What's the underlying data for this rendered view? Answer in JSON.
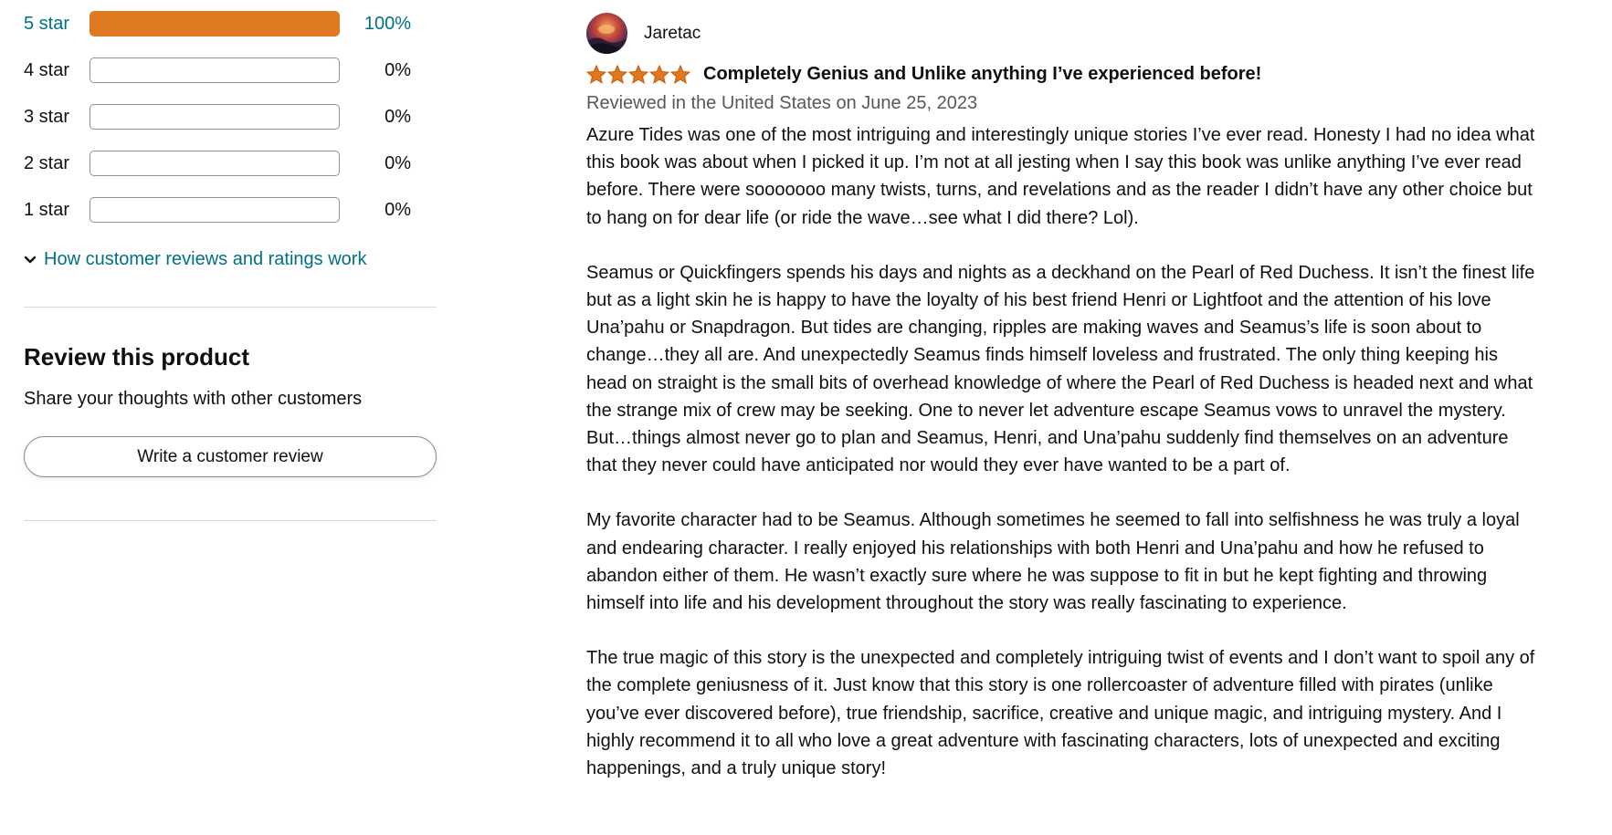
{
  "histogram": {
    "rows": [
      {
        "label": "5 star",
        "percent_label": "100%",
        "fraction": 1.0
      },
      {
        "label": "4 star",
        "percent_label": "0%",
        "fraction": 0.0
      },
      {
        "label": "3 star",
        "percent_label": "0%",
        "fraction": 0.0
      },
      {
        "label": "2 star",
        "percent_label": "0%",
        "fraction": 0.0
      },
      {
        "label": "1 star",
        "percent_label": "0%",
        "fraction": 0.0
      }
    ],
    "how_link": "How customer reviews and ratings work",
    "bar_color": "#de7921"
  },
  "review_product": {
    "title": "Review this product",
    "subtitle": "Share your thoughts with other customers",
    "button_label": "Write a customer review"
  },
  "review": {
    "author": "Jaretac",
    "stars": 5,
    "star_color": "#de7921",
    "headline": "Completely Genius and Unlike anything I’ve experienced before!",
    "date_line": "Reviewed in the United States on June 25, 2023",
    "paragraphs": [
      "Azure Tides was one of the most intriguing and interestingly unique stories I’ve ever read. Honesty I had no idea what this book was about when I picked it up. I’m not at all jesting when I say this book was unlike anything I’ve ever read before. There were sooooooo many twists, turns, and revelations and as the reader I didn’t have any other choice but to hang on for dear life (or ride the wave…see what I did there? Lol).",
      "Seamus or Quickfingers spends his days and nights as a deckhand on the Pearl of Red Duchess. It isn’t the finest life but as a light skin he is happy to have the loyalty of his best friend Henri or Lightfoot and the attention of his love Una’pahu or Snapdragon. But tides are changing, ripples are making waves and Seamus’s life is soon about to change…they all are. And unexpectedly Seamus finds himself loveless and frustrated. The only thing keeping his head on straight is the small bits of overhead knowledge of where the Pearl of Red Duchess is headed next and what the strange mix of crew may be seeking. One to never let adventure escape Seamus vows to unravel the mystery. But…things almost never go to plan and Seamus, Henri, and Una’pahu suddenly find themselves on an adventure that they never could have anticipated nor would they ever have wanted to be a part of.",
      "My favorite character had to be Seamus. Although sometimes he seemed to fall into selfishness he was truly a loyal and endearing character. I really enjoyed his relationships with both Henri and Una’pahu and how he refused to abandon either of them. He wasn’t exactly sure where he was suppose to fit in but he kept fighting and throwing himself into life and his development throughout the story was really fascinating to experience.",
      "The true magic of this story is the unexpected and completely intriguing twist of events and I don’t want to spoil any of the complete geniusness of it. Just know that this story is one rollercoaster of adventure filled with pirates (unlike you’ve ever discovered before), true friendship, sacrifice, creative and unique magic, and intriguing mystery. And I highly recommend it to all who love a great adventure with fascinating characters, lots of unexpected and exciting happenings, and a truly unique story!"
    ]
  }
}
